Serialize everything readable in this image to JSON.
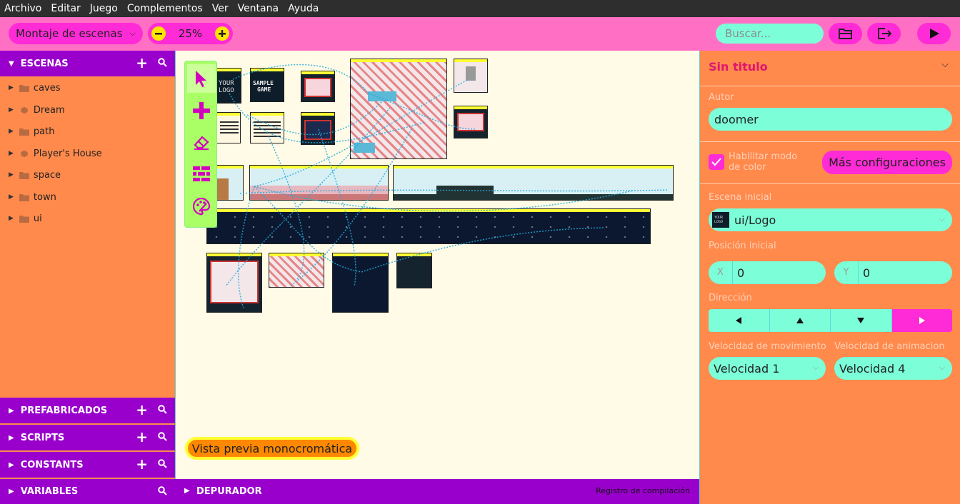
{
  "menu": {
    "items": [
      "Archivo",
      "Editar",
      "Juego",
      "Complementos",
      "Ver",
      "Ventana",
      "Ayuda"
    ]
  },
  "toolbar": {
    "view_select": "Montaje de escenas",
    "zoom": "25%",
    "search_placeholder": "Buscar..."
  },
  "sidebar": {
    "scenes_title": "ESCENAS",
    "scenes": [
      {
        "label": "caves",
        "icon": "folder-icon"
      },
      {
        "label": "Dream",
        "icon": "cube-icon"
      },
      {
        "label": "path",
        "icon": "folder-icon"
      },
      {
        "label": "Player's House",
        "icon": "cube-icon"
      },
      {
        "label": "space",
        "icon": "folder-icon"
      },
      {
        "label": "town",
        "icon": "folder-icon"
      },
      {
        "label": "ui",
        "icon": "folder-icon"
      }
    ],
    "prefabs_title": "PREFABRICADOS",
    "scripts_title": "SCRIPTS",
    "constants_title": "CONSTANTS",
    "variables_title": "VARIABLES"
  },
  "canvas": {
    "mono_preview": "Vista previa monocromática",
    "logo_text_1": "YOUR",
    "logo_text_2": "LOGO",
    "sample_text_1": "SAMPLE",
    "sample_text_2": "GAME"
  },
  "debugger": {
    "title": "DEPURADOR",
    "build_log": "Registro de compilación"
  },
  "properties": {
    "title": "Sin titulo",
    "author_label": "Autor",
    "author_value": "doomer",
    "color_mode_label": "Habilitar modo de color",
    "color_mode_checked": true,
    "more_settings": "Más configuraciones",
    "start_scene_label": "Escena inicial",
    "start_scene_value": "ui/Logo",
    "start_scene_thumb_text_1": "YOUR",
    "start_scene_thumb_text_2": "LOGO",
    "start_pos_label": "Posición inicial",
    "x_label": "X",
    "x_value": "0",
    "y_label": "Y",
    "y_value": "0",
    "direction_label": "Dirección",
    "direction_selected": "right",
    "move_speed_label": "Velocidad de movimiento",
    "move_speed_value": "Velocidad 1",
    "anim_speed_label": "Velocidad de animacion",
    "anim_speed_value": "Velocidad 4"
  },
  "colors": {
    "accent": "#ff2bd6",
    "header": "#9900cc",
    "panel": "#ff8a4c",
    "toolbar": "#ff6fc4",
    "field": "#7cffd8",
    "canvas": "#fffbe6"
  }
}
